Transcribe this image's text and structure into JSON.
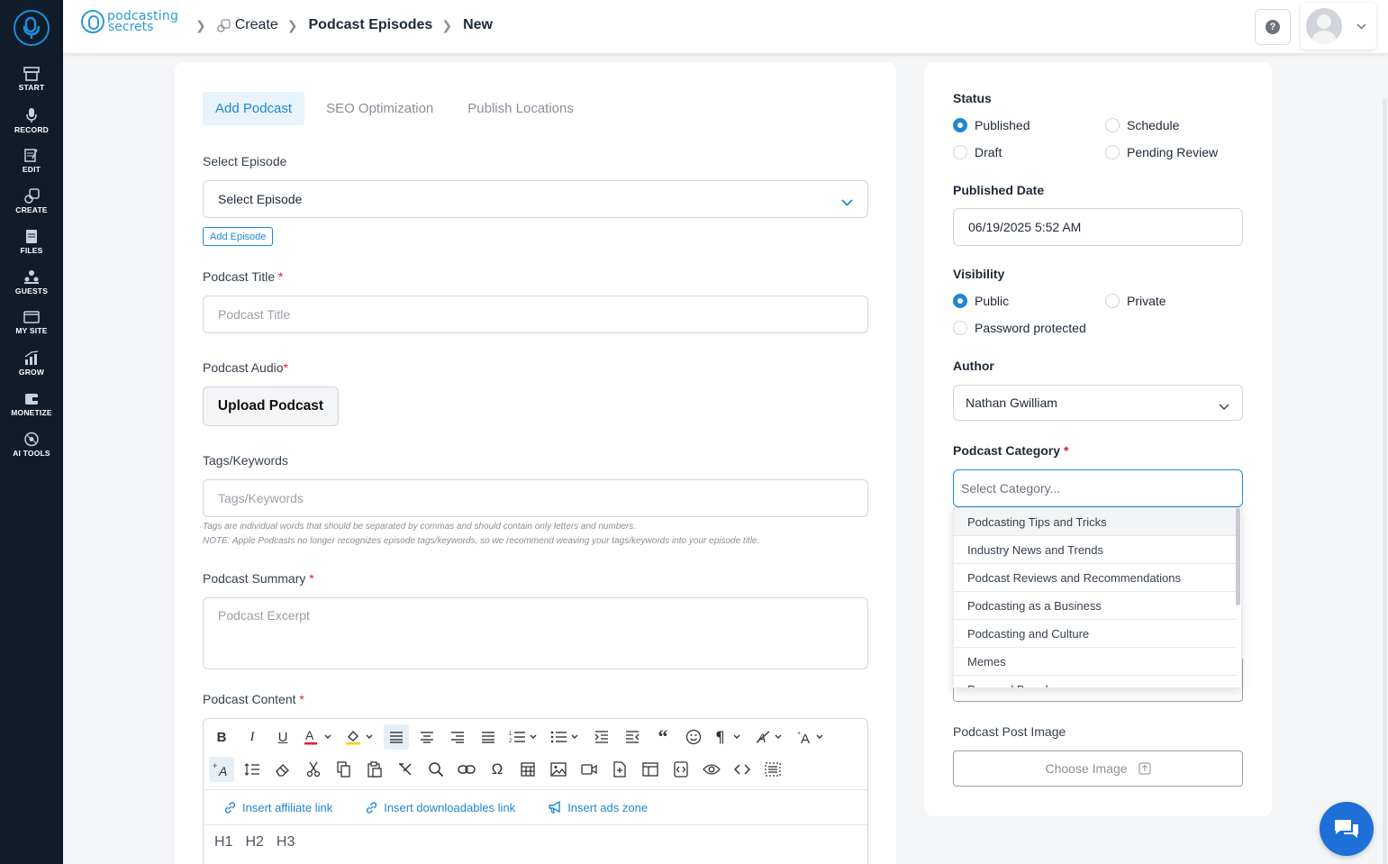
{
  "sidebar": {
    "items": [
      {
        "label": "START",
        "icon": "start-icon"
      },
      {
        "label": "RECORD",
        "icon": "microphone-icon"
      },
      {
        "label": "EDIT",
        "icon": "edit-icon"
      },
      {
        "label": "CREATE",
        "icon": "create-icon"
      },
      {
        "label": "FILES",
        "icon": "files-icon"
      },
      {
        "label": "GUESTS",
        "icon": "guests-icon"
      },
      {
        "label": "MY SITE",
        "icon": "my-site-icon"
      },
      {
        "label": "GROW",
        "icon": "grow-icon"
      },
      {
        "label": "MONETIZE",
        "icon": "monetize-icon"
      },
      {
        "label": "AI TOOLS",
        "icon": "ai-tools-icon"
      }
    ]
  },
  "header": {
    "brand_line1": "podcasting",
    "brand_line2": "secrets",
    "breadcrumb": [
      "Create",
      "Podcast Episodes",
      "New"
    ],
    "help_icon": "?"
  },
  "tabs": [
    "Add Podcast",
    "SEO Optimization",
    "Publish Locations"
  ],
  "form": {
    "select_episode_label": "Select Episode",
    "select_episode_value": "Select Episode",
    "add_episode": "Add Episode",
    "podcast_title_label": "Podcast Title",
    "podcast_title_placeholder": "Podcast Title",
    "podcast_audio_label": "Podcast Audio",
    "upload_podcast": "Upload Podcast",
    "tags_label": "Tags/Keywords",
    "tags_placeholder": "Tags/Keywords",
    "tags_note1": "Tags are individual words that should be separated by commas and should contain only letters and numbers.",
    "tags_note2": "NOTE: Apple Podcasts no longer recognizes episode tags/keywords, so we recommend weaving your tags/keywords into your episode title.",
    "summary_label": "Podcast Summary",
    "summary_placeholder": "Podcast Excerpt",
    "content_label": "Podcast Content",
    "required_mark": "*"
  },
  "editor": {
    "insert_affiliate": "Insert affiliate link",
    "insert_downloadables": "Insert downloadables link",
    "insert_ads": "Insert ads zone",
    "headings": [
      "H1",
      "H2",
      "H3"
    ]
  },
  "side": {
    "status_label": "Status",
    "status_options": [
      "Published",
      "Schedule",
      "Draft",
      "Pending Review"
    ],
    "published_date_label": "Published Date",
    "published_date_value": "06/19/2025 5:52 AM",
    "visibility_label": "Visibility",
    "visibility_options": [
      "Public",
      "Private",
      "Password protected"
    ],
    "author_label": "Author",
    "author_value": "Nathan Gwilliam",
    "category_label": "Podcast Category",
    "category_placeholder": "Select Category...",
    "category_options": [
      "Podcasting Tips and Tricks",
      "Industry News and Trends",
      "Podcast Reviews and Recommendations",
      "Podcasting as a Business",
      "Podcasting and Culture",
      "Memes",
      "Personal Brand"
    ],
    "post_image_label": "Podcast Post Image",
    "choose_image": "Choose Image"
  },
  "colors": {
    "sidebar_bg": "#111c2b",
    "accent": "#1e88d1",
    "required": "#e11d2e"
  }
}
